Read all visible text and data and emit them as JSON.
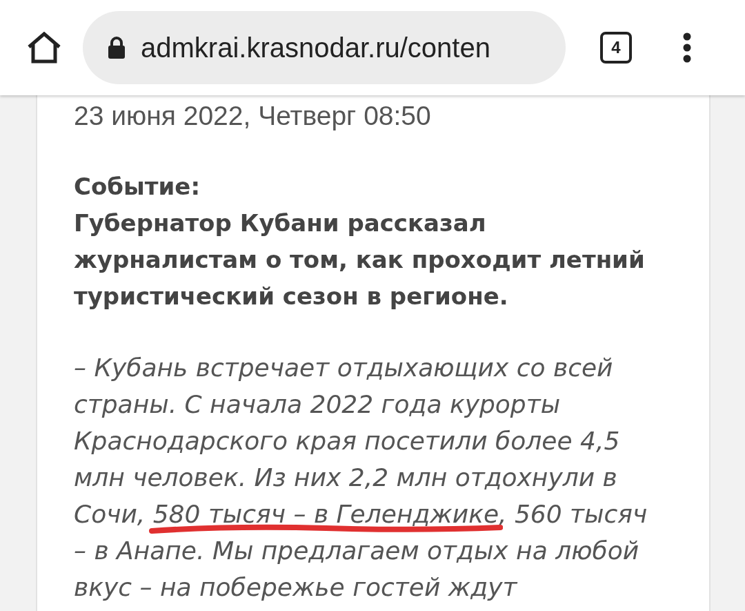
{
  "browser": {
    "url": "admkrai.krasnodar.ru/conten",
    "tab_count": "4"
  },
  "article": {
    "date": "23 июня 2022, Четверг 08:50",
    "event_label": "Событие:",
    "headline": "Губернатор Кубани рассказал журналистам о том, как проходит летний туристический сезон в регионе.",
    "quote": {
      "before": "– Кубань встречает отдыхающих со всей страны. С начала 2022 года курорты Краснодарского края посетили более 4,5 млн человек. Из них 2,2 млн отдохнули в Сочи, ",
      "underlined": "580 тысяч – в Геленджике",
      "after": ", 560 тысяч – в Анапе. Мы предлагаем отдых на любой вкус – на побережье гостей ждут"
    }
  }
}
